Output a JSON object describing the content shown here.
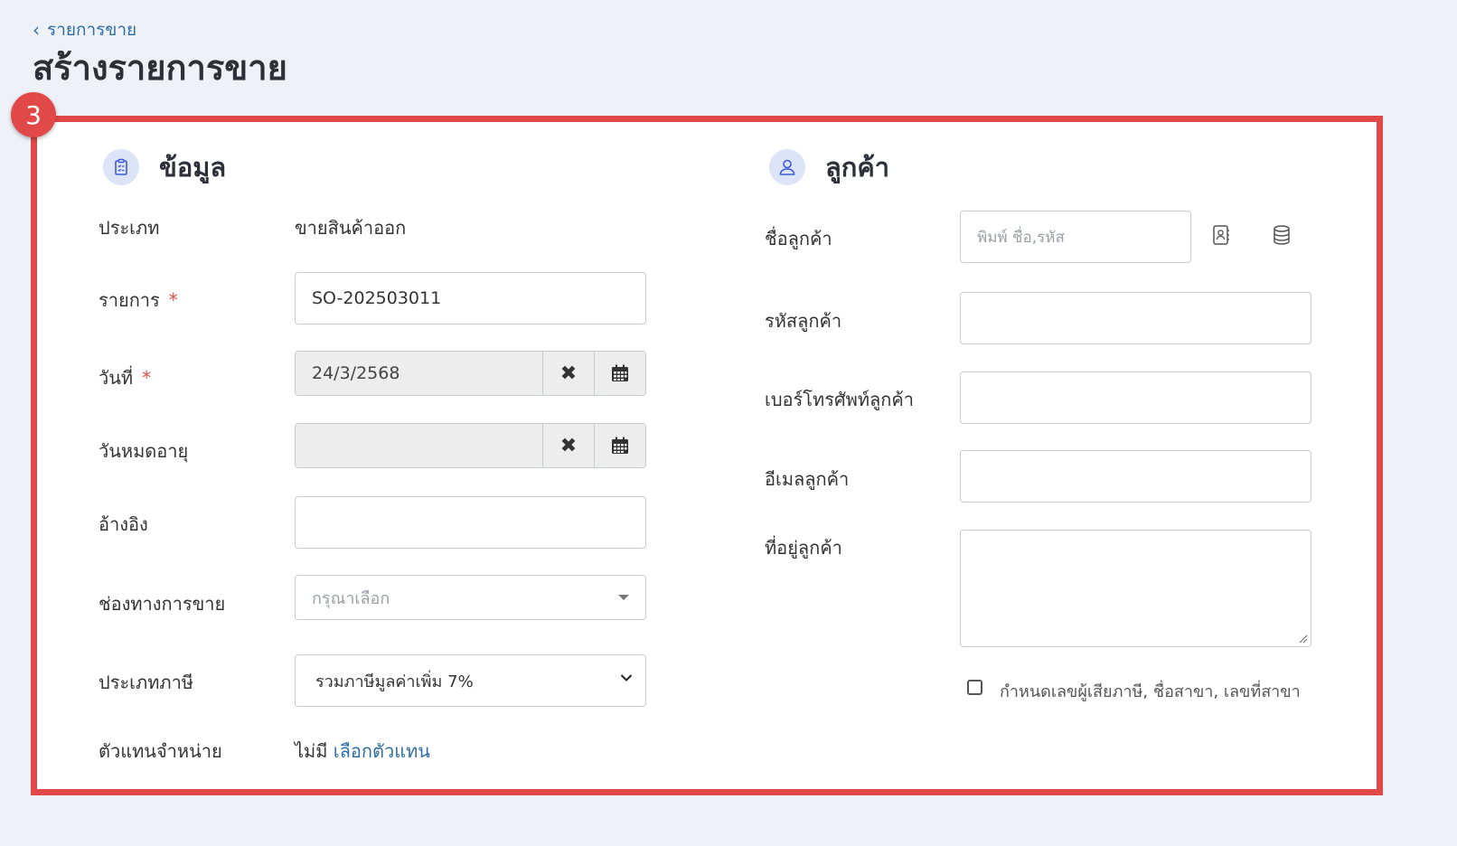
{
  "breadcrumb": {
    "back_label": "รายการขาย"
  },
  "page_title": "สร้างรายการขาย",
  "step_badge": "3",
  "info_section": {
    "title": "ข้อมูล",
    "icon": "clipboard-list-icon",
    "fields": {
      "type": {
        "label": "ประเภท",
        "value": "ขายสินค้าออก"
      },
      "doc_no": {
        "label": "รายการ",
        "required": "*",
        "value": "SO-202503011"
      },
      "date": {
        "label": "วันที่",
        "required": "*",
        "value": "24/3/2568"
      },
      "expiry": {
        "label": "วันหมดอายุ",
        "value": ""
      },
      "reference": {
        "label": "อ้างอิง",
        "value": ""
      },
      "channel": {
        "label": "ช่องทางการขาย",
        "placeholder": "กรุณาเลือก"
      },
      "tax_type": {
        "label": "ประเภทภาษี",
        "selected": "รวมภาษีมูลค่าเพิ่ม 7%"
      },
      "agent": {
        "label": "ตัวแทนจำหน่าย",
        "value": "ไม่มี",
        "action": "เลือกตัวแทน"
      }
    }
  },
  "customer_section": {
    "title": "ลูกค้า",
    "icon": "user-icon",
    "fields": {
      "name": {
        "label": "ชื่อลูกค้า",
        "placeholder": "พิมพ์ ชื่อ,รหัส"
      },
      "code": {
        "label": "รหัสลูกค้า",
        "value": ""
      },
      "phone": {
        "label": "เบอร์โทรศัพท์ลูกค้า",
        "value": ""
      },
      "email": {
        "label": "อีเมลลูกค้า",
        "value": ""
      },
      "address": {
        "label": "ที่อยู่ลูกค้า",
        "value": ""
      }
    },
    "tax_checkbox_label": "กำหนดเลขผู้เสียภาษี, ชื่อสาขา, เลขที่สาขา",
    "tax_checkbox_checked": false
  },
  "colors": {
    "highlight": "#e14848",
    "link": "#2e6da4",
    "background": "#eef1f8"
  }
}
